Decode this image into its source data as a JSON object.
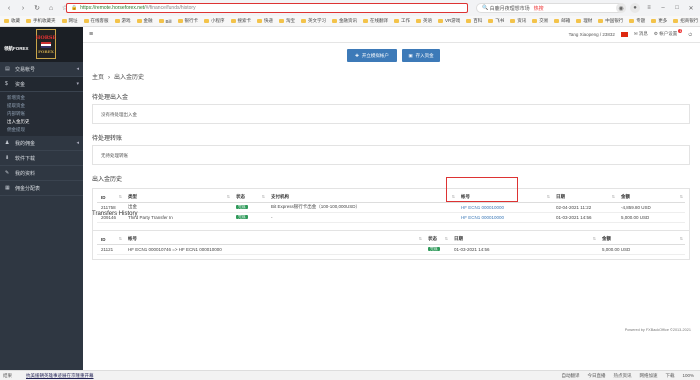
{
  "browser": {
    "url_secure": "https://",
    "url_host": "remote.horseforex.net/",
    "url_rest": "#/finance/funds/history",
    "search_text": "白鹿月夜理想市场",
    "search_hot": "热搜",
    "bookmarks": [
      "收藏",
      "手机收藏夹",
      "网址",
      "在线客服",
      "游戏",
      "金融",
      "Bill",
      "银行卡",
      "小程序",
      "搜索卡",
      "快递",
      "淘宝",
      "英文学习",
      "金融资讯",
      "在线翻译",
      "工作",
      "英语",
      "VR游戏",
      "百科",
      "飞书",
      "资讯",
      "交易",
      "邮箱",
      "理财",
      "中国银行",
      "专题",
      "更多",
      "招商银行"
    ]
  },
  "sidebar": {
    "brand_small": "领航FOREX",
    "logo_line1": "HORSE",
    "logo_line2": "FOREX",
    "items": [
      {
        "icon": "▤",
        "label": "交易帐号",
        "has_arrow": true
      },
      {
        "icon": "$",
        "label": "资金",
        "has_arrow": true,
        "active": true
      }
    ],
    "sub_items": [
      "新增资金",
      "提取资金",
      "内部转账",
      "出入金历史",
      "佣金提现"
    ],
    "current_sub": 3,
    "more_items": [
      {
        "icon": "♟",
        "label": "我的佣金",
        "has_arrow": true
      },
      {
        "icon": "⬇",
        "label": "软件下载",
        "has_arrow": false
      },
      {
        "icon": "✎",
        "label": "我的资料",
        "has_arrow": false
      },
      {
        "icon": "▦",
        "label": "佣金分配表",
        "has_arrow": false
      }
    ]
  },
  "header": {
    "user": "Tang Xiaopeng / 23832",
    "messages": "消息",
    "settings": "帐户设置",
    "badge": "1"
  },
  "actions": {
    "open_account": "开立模拟帐户",
    "deposit": "存入资金"
  },
  "breadcrumb": {
    "home": "主页",
    "current": "出入金历史"
  },
  "pending_funds": {
    "title": "待处理出入金",
    "empty": "没有待处理出入金"
  },
  "pending_transfers": {
    "title": "待处理转账",
    "empty": "无待处理转账"
  },
  "funds_history": {
    "title": "出入金历史",
    "headers": [
      "ID",
      "类型",
      "状态",
      "支付机构",
      "帐号",
      "日期",
      "金额"
    ],
    "rows": [
      {
        "id": "211758",
        "type": "出金",
        "status": "完成",
        "method": "Bit Express银行卡出金（100-100,000USD）",
        "account": "HF ECN1 000010000",
        "date": "02-04-2021 11:22",
        "amount": "-4,859.80 USD"
      },
      {
        "id": "209146",
        "type": "Third Party Transfer In",
        "status": "完成",
        "method": "-",
        "account": "HF ECN1 000010000",
        "date": "01-03-2021 14:56",
        "amount": "5,000.00 USD"
      }
    ]
  },
  "transfers_history": {
    "title": "Transfers History",
    "headers": [
      "ID",
      "帐号",
      "状态",
      "日期",
      "金额"
    ],
    "rows": [
      {
        "id": "21121",
        "account": "HF ECN1 000010746 => HF ECN1 000010000",
        "status": "完成",
        "date": "01-03-2021 14:56",
        "amount": "5,000.00 USD"
      }
    ]
  },
  "footer": {
    "powered": "Powered by FXBackOffice ©2013-2021"
  },
  "statusbar": {
    "left": "结果",
    "news": "抗美援朝英雄事迹展在京隆重开幕",
    "right": [
      "自动翻译",
      "今日直播",
      "热点资讯",
      "网络加速",
      "下载",
      "100%"
    ]
  }
}
